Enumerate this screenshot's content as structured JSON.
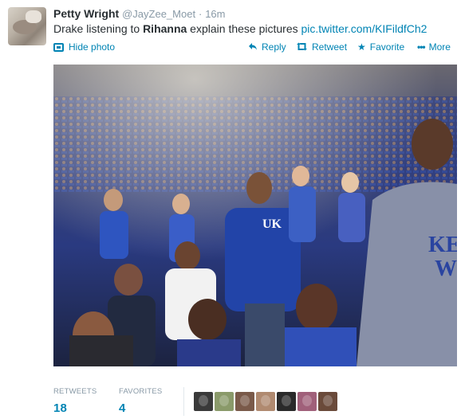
{
  "tweet": {
    "fullname": "Petty Wright",
    "username": "@JayZee_Moet",
    "separator": "·",
    "time": "16m",
    "text_before": "Drake listening to ",
    "text_bold": "Rihanna",
    "text_after": " explain these pictures ",
    "text_link": "pic.twitter.com/KIFildfCh2"
  },
  "actions": {
    "hide_photo": "Hide photo",
    "reply": "Reply",
    "retweet": "Retweet",
    "favorite": "Favorite",
    "more": "More"
  },
  "stats": {
    "retweets_label": "RETWEETS",
    "retweets_count": "18",
    "favorites_label": "FAVORITES",
    "favorites_count": "4"
  },
  "favoriters": [
    {
      "name": "favoriter-avatar-1",
      "color": "#3a3a3a"
    },
    {
      "name": "favoriter-avatar-2",
      "color": "#8a9a6a"
    },
    {
      "name": "favoriter-avatar-3",
      "color": "#7a5a4a"
    },
    {
      "name": "favoriter-avatar-4",
      "color": "#b08a70"
    },
    {
      "name": "favoriter-avatar-5",
      "color": "#2a2a2a"
    },
    {
      "name": "favoriter-avatar-6",
      "color": "#a0607a"
    },
    {
      "name": "favoriter-avatar-7",
      "color": "#6a4a3a"
    }
  ],
  "colors": {
    "link": "#0084b4",
    "text": "#292f33",
    "muted": "#8899a6"
  },
  "icons": {
    "hide_photo": "photo-icon",
    "reply": "reply-icon",
    "retweet": "retweet-icon",
    "favorite": "star-icon",
    "more": "more-dots-icon"
  }
}
